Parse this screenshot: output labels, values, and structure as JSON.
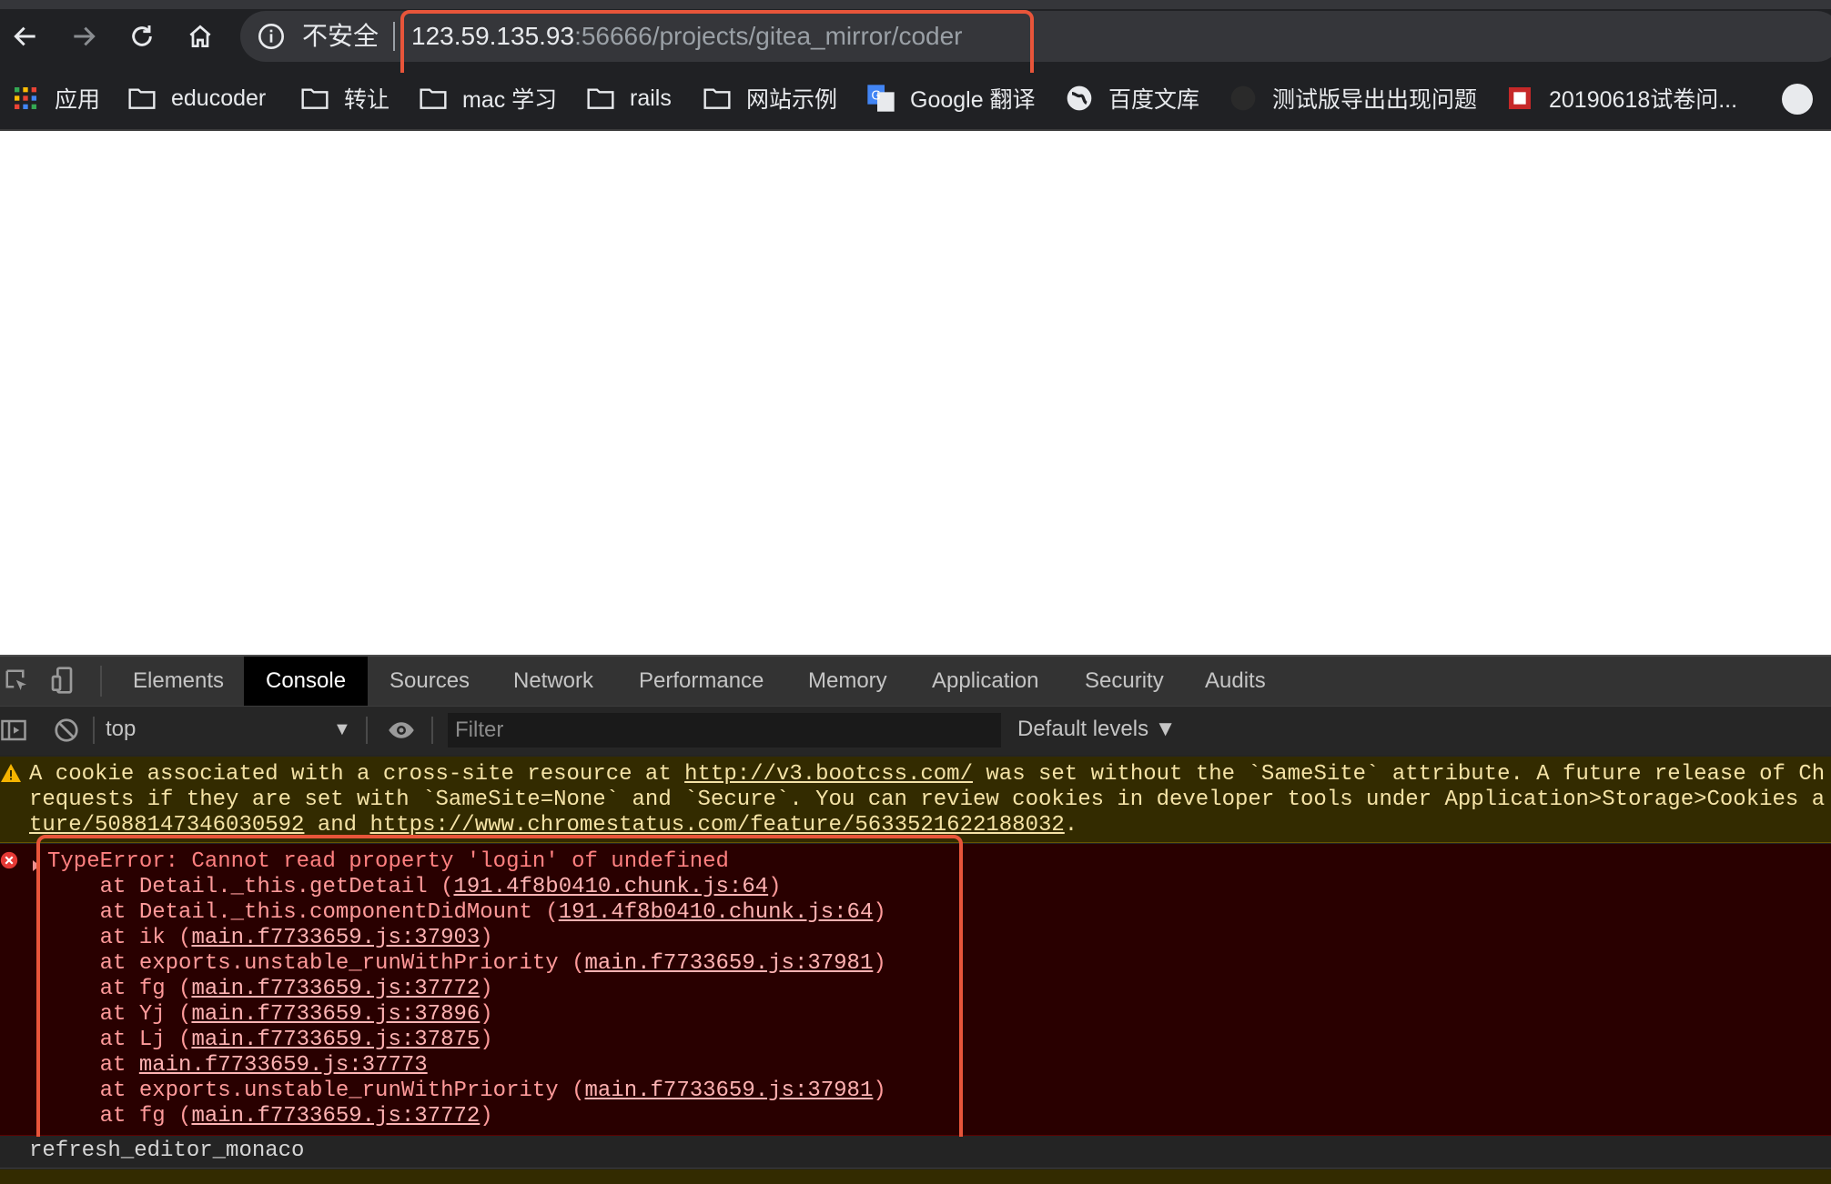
{
  "browser": {
    "security_label": "不安全",
    "url_host": "123.59.135.93",
    "url_rest": ":56666/projects/gitea_mirror/coder",
    "bookmarks": [
      {
        "label": "应用",
        "icon": "apps-grid-icon"
      },
      {
        "label": "educoder",
        "icon": "folder-icon"
      },
      {
        "label": "转让",
        "icon": "folder-icon"
      },
      {
        "label": "mac 学习",
        "icon": "folder-icon"
      },
      {
        "label": "rails",
        "icon": "folder-icon"
      },
      {
        "label": "网站示例",
        "icon": "folder-icon"
      },
      {
        "label": "Google 翻译",
        "icon": "google-translate-icon"
      },
      {
        "label": "百度文库",
        "icon": "globe-icon"
      },
      {
        "label": "测试版导出出现问题",
        "icon": "favicon-icon"
      },
      {
        "label": "20190618试卷问...",
        "icon": "favicon-icon"
      }
    ]
  },
  "devtools": {
    "tabs": [
      "Elements",
      "Console",
      "Sources",
      "Network",
      "Performance",
      "Memory",
      "Application",
      "Security",
      "Audits"
    ],
    "active_tab": "Console",
    "context": "top",
    "filter_placeholder": "Filter",
    "levels": "Default levels ▼"
  },
  "console": {
    "warning": {
      "line1_a": "A cookie associated with a cross-site resource at ",
      "line1_link": "http://v3.bootcss.com/",
      "line1_b": " was set without the `SameSite` attribute. A future release of Ch",
      "line2": "requests if they are set with `SameSite=None` and `Secure`. You can review cookies in developer tools under Application>Storage>Cookies a",
      "line3_link1": "ture/5088147346030592",
      "line3_and": " and ",
      "line3_link2": "https://www.chromestatus.com/feature/5633521622188032",
      "line3_end": "."
    },
    "error": {
      "message": "TypeError: Cannot read property 'login' of undefined",
      "stack": [
        {
          "prefix": "    at Detail._this.getDetail (",
          "link": "191.4f8b0410.chunk.js:64",
          "suffix": ")"
        },
        {
          "prefix": "    at Detail._this.componentDidMount (",
          "link": "191.4f8b0410.chunk.js:64",
          "suffix": ")"
        },
        {
          "prefix": "    at ik (",
          "link": "main.f7733659.js:37903",
          "suffix": ")"
        },
        {
          "prefix": "    at exports.unstable_runWithPriority (",
          "link": "main.f7733659.js:37981",
          "suffix": ")"
        },
        {
          "prefix": "    at fg (",
          "link": "main.f7733659.js:37772",
          "suffix": ")"
        },
        {
          "prefix": "    at Yj (",
          "link": "main.f7733659.js:37896",
          "suffix": ")"
        },
        {
          "prefix": "    at Lj (",
          "link": "main.f7733659.js:37875",
          "suffix": ")"
        },
        {
          "prefix": "    at ",
          "link": "main.f7733659.js:37773",
          "suffix": ""
        },
        {
          "prefix": "    at exports.unstable_runWithPriority (",
          "link": "main.f7733659.js:37981",
          "suffix": ")"
        },
        {
          "prefix": "    at fg (",
          "link": "main.f7733659.js:37772",
          "suffix": ")"
        }
      ]
    },
    "log": "refresh_editor_monaco"
  },
  "colors": {
    "highlight": "#e8553a",
    "error_text": "#ff8080",
    "warning_text": "#f5e3a6"
  }
}
